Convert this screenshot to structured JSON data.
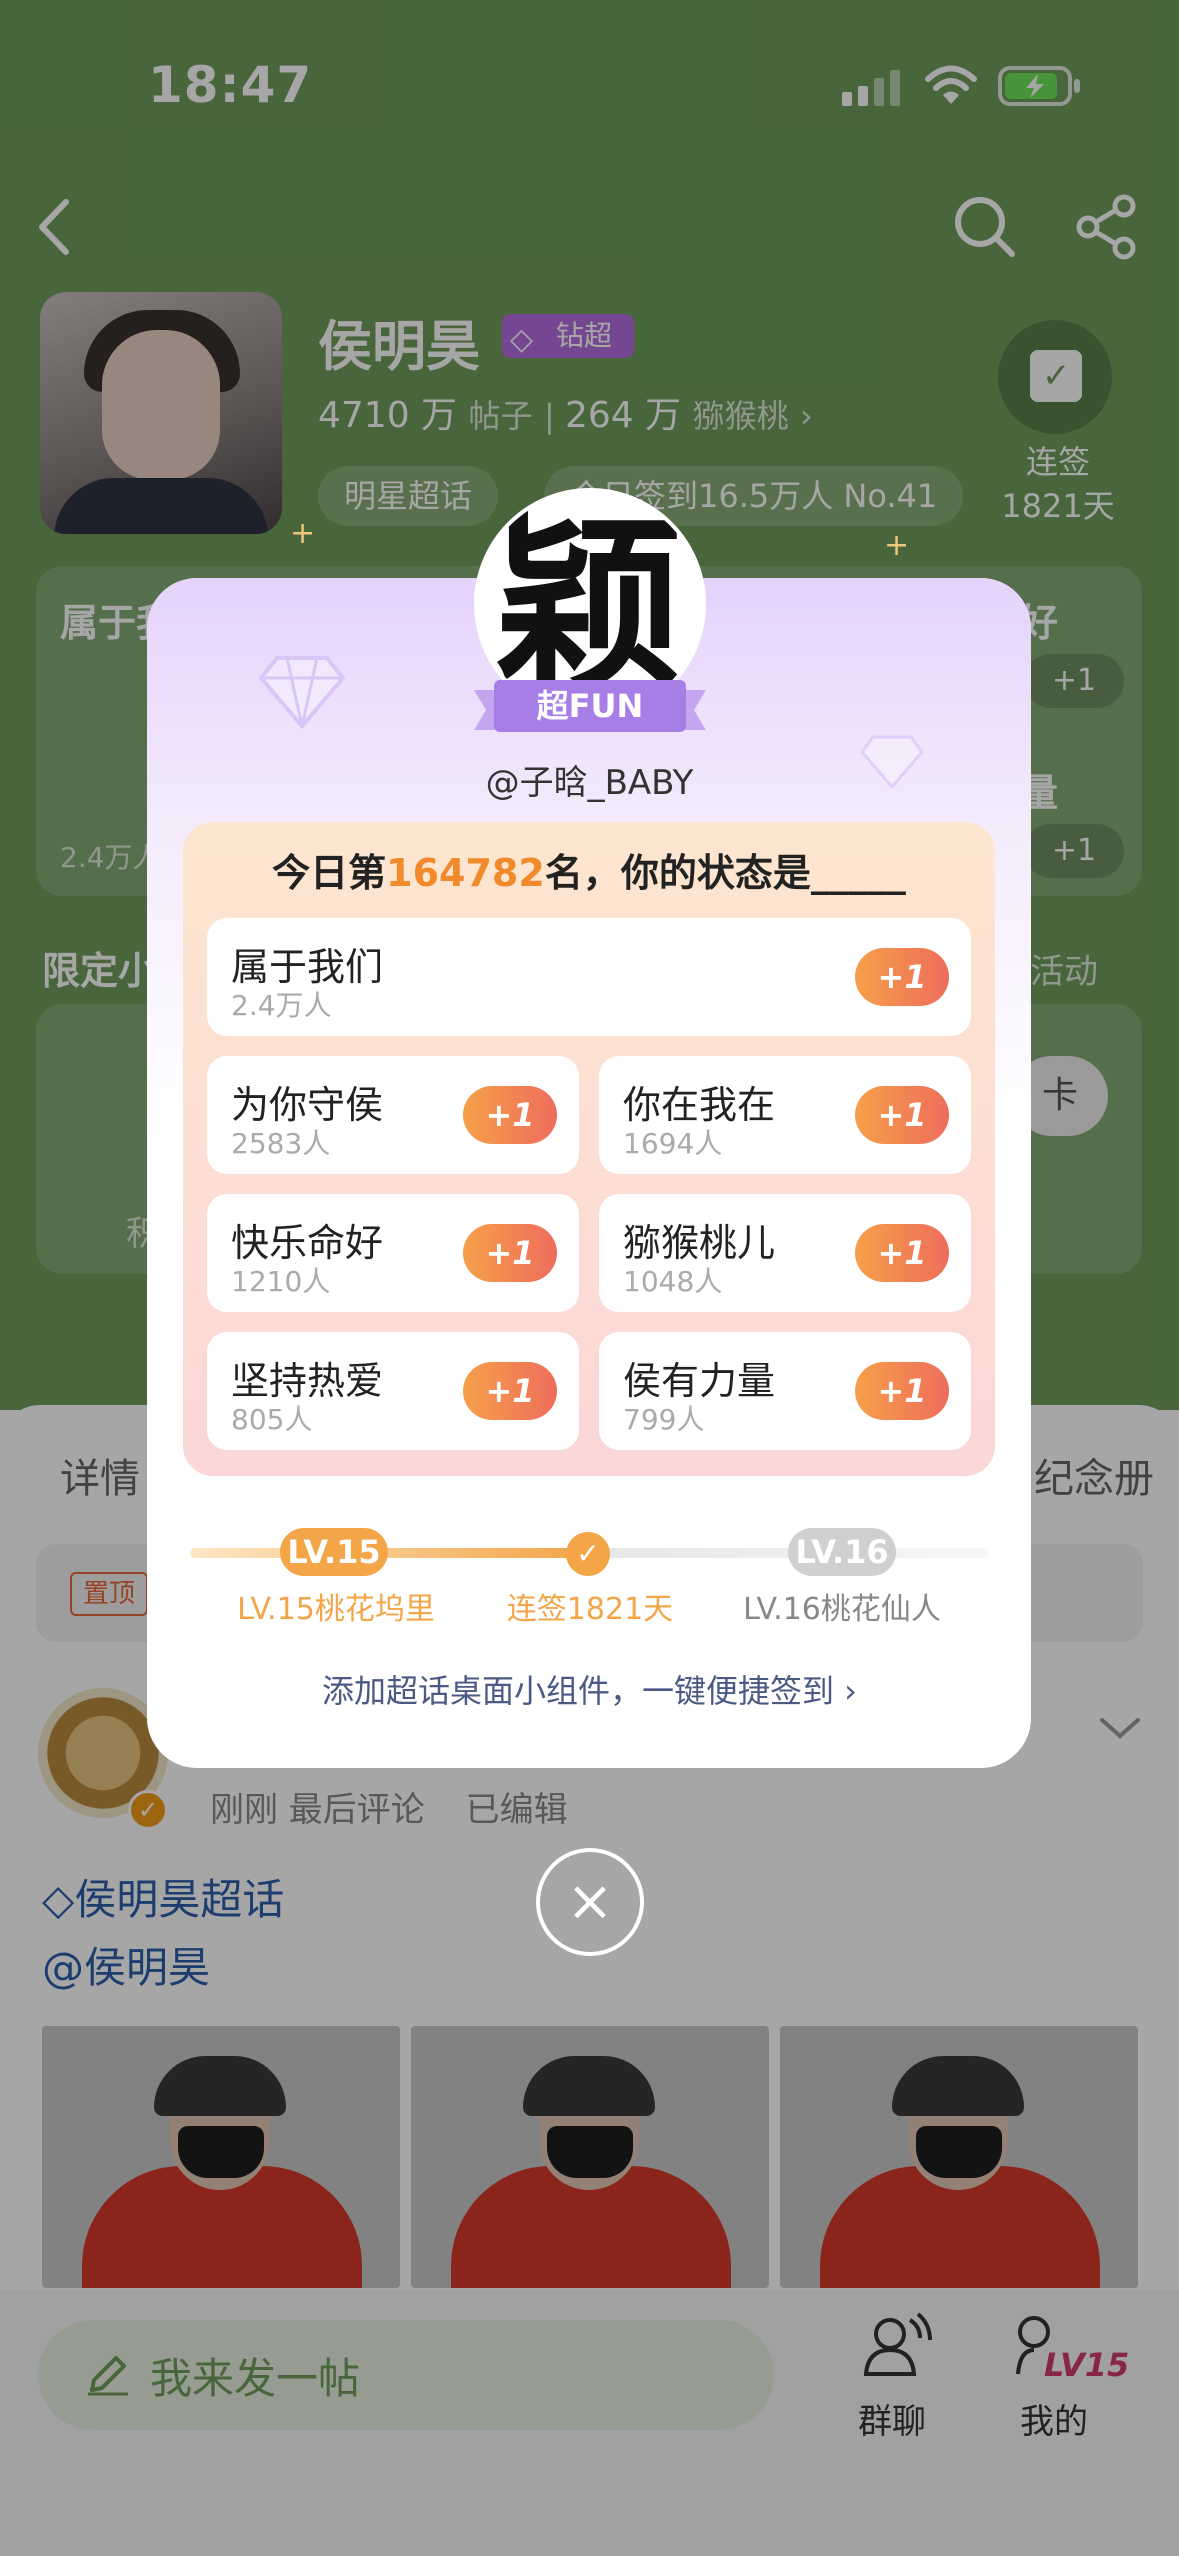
{
  "status_bar": {
    "time": "18:47"
  },
  "profile": {
    "name": "侯明昊",
    "badge": "钻超",
    "posts_count": "4710 万",
    "posts_label": "帖子",
    "fans_count": "264 万",
    "fans_label": "猕猴桃",
    "pill_supertopic": "明星超话",
    "pill_checkin_prefix": "今日签到16.5万人 No.41",
    "checkin_label": "连签",
    "checkin_days": "1821天"
  },
  "background": {
    "section_left": "属于我们",
    "section_left_count": "2.4万人",
    "section_right_top": "好",
    "section_right_mid": "量",
    "limited_title": "限定小",
    "activity_link": "活动",
    "card_btn": "卡",
    "small_label": "积",
    "tab_details": "详情",
    "tab_album": "纪念册",
    "pinned_tag": "置顶",
    "post_meta": "刚刚 最后评论",
    "post_edited": "已编辑",
    "post_line1": "侯明昊超话",
    "post_line2": "@侯明昊",
    "compose_placeholder": "我来发一帖",
    "nav_chat": "群聊",
    "nav_mine": "我的",
    "nav_mine_level": "LV15"
  },
  "modal": {
    "avatar_char": "颖",
    "fun_label": "超FUN",
    "username": "@子晗_BABY",
    "rank_prefix": "今日第",
    "rank_number": "164782",
    "rank_suffix": "名，你的状态是_____",
    "options": [
      {
        "title": "属于我们",
        "count": "2.4万人",
        "plus": "+1"
      },
      {
        "title": "为你守侯",
        "count": "2583人",
        "plus": "+1"
      },
      {
        "title": "你在我在",
        "count": "1694人",
        "plus": "+1"
      },
      {
        "title": "快乐命好",
        "count": "1210人",
        "plus": "+1"
      },
      {
        "title": "猕猴桃儿",
        "count": "1048人",
        "plus": "+1"
      },
      {
        "title": "坚持热爱",
        "count": "805人",
        "plus": "+1"
      },
      {
        "title": "侯有力量",
        "count": "799人",
        "plus": "+1"
      }
    ],
    "level_current": "LV.15",
    "level_next": "LV.16",
    "level_current_label": "LV.15桃花坞里",
    "checkin_label": "连签1821天",
    "level_next_label": "LV.16桃花仙人",
    "widget_link": "添加超话桌面小组件，一键便捷签到 ›",
    "colors": {
      "accent_orange": "#f08a2a",
      "lilac": "#a77ee6",
      "brand_green": "#6f9c5c"
    }
  }
}
